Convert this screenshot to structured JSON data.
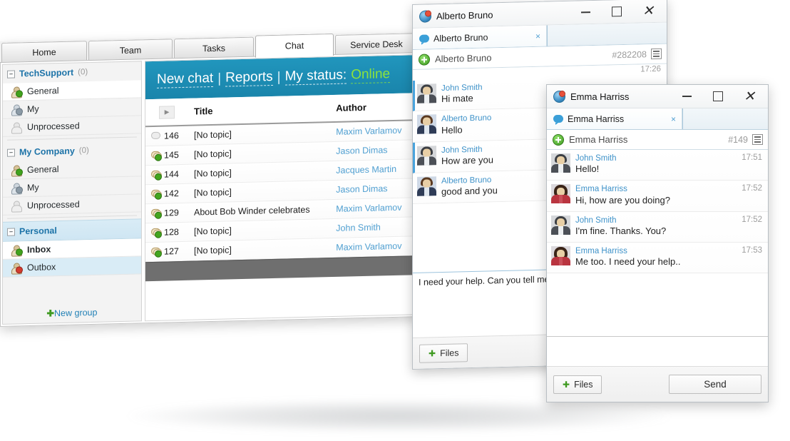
{
  "app": {
    "tabs": [
      {
        "label": "Home",
        "active": false
      },
      {
        "label": "Team",
        "active": false
      },
      {
        "label": "Tasks",
        "active": false
      },
      {
        "label": "Chat",
        "active": true
      },
      {
        "label": "Service Desk",
        "active": false
      }
    ],
    "accent_blue": "#1d8db4",
    "link_blue": "#4f9fd1",
    "online_green": "#8de33c"
  },
  "sidebar": {
    "groups": [
      {
        "title": "TechSupport",
        "count": "(0)",
        "items": [
          {
            "label": "General",
            "icon": "person-green-icon",
            "state": "selected"
          },
          {
            "label": "My",
            "icon": "person-blue-icon",
            "state": "normal"
          },
          {
            "label": "Unprocessed",
            "icon": "person-grey-icon",
            "state": "normal"
          }
        ]
      },
      {
        "title": "My Company",
        "count": "(0)",
        "items": [
          {
            "label": "General",
            "icon": "person-green-icon",
            "state": "normal"
          },
          {
            "label": "My",
            "icon": "person-blue-icon",
            "state": "normal"
          },
          {
            "label": "Unprocessed",
            "icon": "person-grey-icon",
            "state": "normal"
          }
        ]
      },
      {
        "title": "Personal",
        "count": "",
        "highlight": true,
        "items": [
          {
            "label": "Inbox",
            "icon": "person-green-icon",
            "state": "selected-bold"
          },
          {
            "label": "Outbox",
            "icon": "person-red-icon",
            "state": "tinted"
          }
        ]
      }
    ],
    "new_group_label": "New group",
    "new_group_icon": "plus-icon"
  },
  "toolbar": {
    "new_chat": "New chat",
    "reports": "Reports",
    "my_status_label": "My status:",
    "my_status_value": "Online",
    "separator": "|"
  },
  "chat_list": {
    "columns": [
      "",
      "Title",
      "Author"
    ],
    "sort_icon": "sort-arrow-icon",
    "rows": [
      {
        "icon": "bubble-plain-icon",
        "id": "146",
        "title": "[No topic]",
        "author": "Maxim Varlamov"
      },
      {
        "icon": "bubble-read-icon",
        "id": "145",
        "title": "[No topic]",
        "author": "Jason Dimas"
      },
      {
        "icon": "bubble-read-icon",
        "id": "144",
        "title": "[No topic]",
        "author": "Jacques Martin"
      },
      {
        "icon": "bubble-read-icon",
        "id": "142",
        "title": "[No topic]",
        "author": "Jason Dimas"
      },
      {
        "icon": "bubble-read-icon",
        "id": "129",
        "title": "About Bob Winder celebrates",
        "author": "Maxim Varlamov"
      },
      {
        "icon": "bubble-read-icon",
        "id": "128",
        "title": "[No topic]",
        "author": "John Smith"
      },
      {
        "icon": "bubble-read-icon",
        "id": "127",
        "title": "[No topic]",
        "author": "Maxim Varlamov"
      }
    ]
  },
  "chat_windows": [
    {
      "id": "alberto",
      "title": "Alberto Bruno",
      "tab_label": "Alberto Bruno",
      "tab_close": "×",
      "subject": "Alberto Bruno",
      "ticket": "#282208",
      "top_time": "17:26",
      "messages": [
        {
          "author": "John Smith",
          "text": "Hi mate",
          "avatar": "man",
          "self": true,
          "time": ""
        },
        {
          "author": "Alberto Bruno",
          "text": "Hello",
          "avatar": "al",
          "self": false,
          "time": ""
        },
        {
          "author": "John Smith",
          "text": "How are you",
          "avatar": "man",
          "self": true,
          "time": ""
        },
        {
          "author": "Alberto Bruno",
          "text": "good and you",
          "avatar": "al",
          "self": false,
          "time": ""
        }
      ],
      "input_value": "I need your help. Can you tell me",
      "files_label": "Files",
      "window_buttons": [
        "minimize-icon",
        "maximize-icon",
        "close-icon"
      ]
    },
    {
      "id": "emma",
      "title": "Emma Harriss",
      "tab_label": "Emma Harriss",
      "tab_close": "×",
      "subject": "Emma Harriss",
      "ticket": "#149",
      "messages": [
        {
          "author": "John Smith",
          "text": "Hello!",
          "avatar": "man",
          "self": false,
          "time": "17:51"
        },
        {
          "author": "Emma Harriss",
          "text": "Hi, how are you doing?",
          "avatar": "em",
          "self": false,
          "time": "17:52"
        },
        {
          "author": "John Smith",
          "text": "I'm fine. Thanks. You?",
          "avatar": "man",
          "self": false,
          "time": "17:52"
        },
        {
          "author": "Emma Harriss",
          "text": "Me too. I need your help..",
          "avatar": "em",
          "self": false,
          "time": "17:53"
        }
      ],
      "input_value": "",
      "files_label": "Files",
      "send_label": "Send",
      "window_buttons": [
        "minimize-icon",
        "maximize-icon",
        "close-icon"
      ]
    }
  ]
}
